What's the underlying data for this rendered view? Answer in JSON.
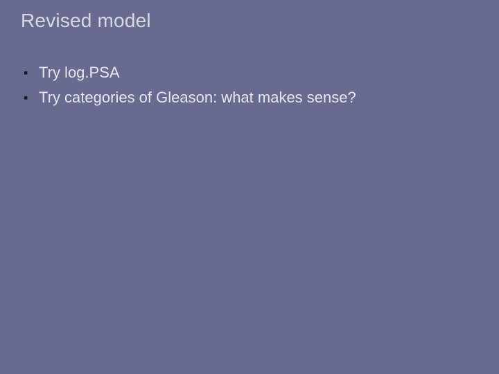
{
  "slide": {
    "title": "Revised model",
    "bullets": [
      {
        "text": "Try log.PSA"
      },
      {
        "text": "Try categories of Gleason:  what makes sense?"
      }
    ]
  }
}
